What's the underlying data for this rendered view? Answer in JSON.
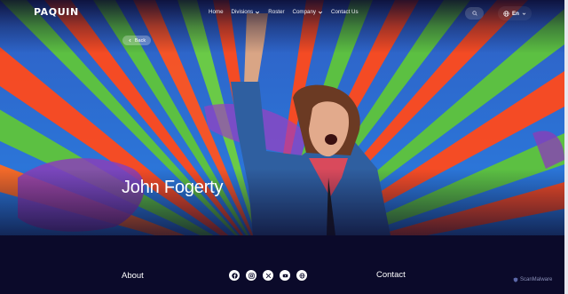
{
  "brand": {
    "logo_text": "PAQUIN"
  },
  "nav": {
    "items": [
      {
        "label": "Home",
        "has_dropdown": false
      },
      {
        "label": "Divisions",
        "has_dropdown": true
      },
      {
        "label": "Roster",
        "has_dropdown": false
      },
      {
        "label": "Company",
        "has_dropdown": true
      },
      {
        "label": "Contact Us",
        "has_dropdown": false
      }
    ],
    "search_icon": "search-icon",
    "language": {
      "label": "En",
      "icon": "globe-icon"
    }
  },
  "hero": {
    "back_label": "Back",
    "title": "John Fogerty"
  },
  "footer": {
    "about_label": "About",
    "contact_label": "Contact",
    "socials": [
      "facebook-icon",
      "instagram-icon",
      "x-icon",
      "youtube-icon",
      "globe-icon"
    ]
  },
  "watermark": {
    "text": "ScanMalware"
  },
  "colors": {
    "background": "#0b0a2a",
    "mural_blue": "#2a6fd0",
    "mural_orange": "#ff4a1c",
    "mural_green": "#5fc53b",
    "text": "#ffffff"
  }
}
